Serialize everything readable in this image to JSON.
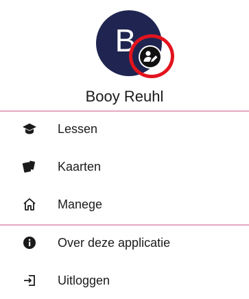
{
  "profile": {
    "initial": "B",
    "name": "Booy Reuhl",
    "edit_badge_icon": "person-edit-icon",
    "highlight_color": "#e2141e",
    "avatar_color": "#1f2550"
  },
  "menu": {
    "section1": [
      {
        "label": "Lessen",
        "icon": "graduation-cap-icon"
      },
      {
        "label": "Kaarten",
        "icon": "cards-icon"
      },
      {
        "label": "Manege",
        "icon": "home-icon"
      }
    ],
    "section2": [
      {
        "label": "Over deze applicatie",
        "icon": "info-icon"
      },
      {
        "label": "Uitloggen",
        "icon": "logout-icon"
      }
    ]
  },
  "divider_color": "#e7a6c0"
}
